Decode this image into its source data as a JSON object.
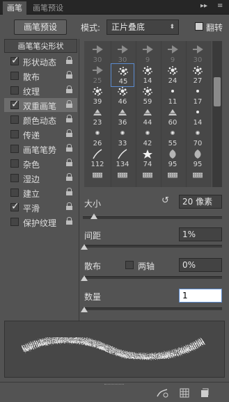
{
  "tabs": [
    {
      "label": "画笔",
      "active": true
    },
    {
      "label": "画笔预设",
      "active": false
    }
  ],
  "tabbar_controls": {
    "collapse": "▸▸",
    "menu": "≡"
  },
  "preset_button": "画笔预设",
  "mode": {
    "label": "模式:",
    "value": "正片叠底",
    "arrow": "⬍"
  },
  "flip": {
    "label": "翻转",
    "checked": false
  },
  "list": {
    "header": "画笔笔尖形状",
    "items": [
      {
        "label": "形状动态",
        "checked": true,
        "selected": false
      },
      {
        "label": "散布",
        "checked": false,
        "selected": false
      },
      {
        "label": "纹理",
        "checked": false,
        "selected": false
      },
      {
        "label": "双重画笔",
        "checked": true,
        "selected": true
      },
      {
        "label": "颜色动态",
        "checked": false,
        "selected": false
      },
      {
        "label": "传递",
        "checked": false,
        "selected": false
      },
      {
        "label": "画笔笔势",
        "checked": false,
        "selected": false
      },
      {
        "label": "杂色",
        "checked": false,
        "selected": false
      },
      {
        "label": "湿边",
        "checked": false,
        "selected": false
      },
      {
        "label": "建立",
        "checked": false,
        "selected": false
      },
      {
        "label": "平滑",
        "checked": true,
        "selected": false
      },
      {
        "label": "保护纹理",
        "checked": false,
        "selected": false
      }
    ]
  },
  "brushes": [
    {
      "num": "30",
      "dim": true,
      "icon": "arrow-brush-icon"
    },
    {
      "num": "30",
      "dim": true,
      "icon": "arrow-brush-icon"
    },
    {
      "num": "9",
      "dim": true,
      "icon": "arrow-brush-icon"
    },
    {
      "num": "9",
      "dim": true,
      "icon": "arrow-brush-icon"
    },
    {
      "num": "30",
      "dim": true,
      "icon": "arrow-brush-icon"
    },
    {
      "num": "25",
      "dim": true,
      "icon": "arrow-brush-icon"
    },
    {
      "num": "45",
      "dim": false,
      "selected": true,
      "icon": "splatter-brush-icon"
    },
    {
      "num": "14",
      "dim": false,
      "icon": "scatter-brush-icon"
    },
    {
      "num": "24",
      "dim": false,
      "icon": "scatter-brush-icon"
    },
    {
      "num": "27",
      "dim": false,
      "icon": "scatter-brush-icon"
    },
    {
      "num": "39",
      "dim": false,
      "icon": "scatter-brush-icon"
    },
    {
      "num": "46",
      "dim": false,
      "icon": "scatter-brush-icon"
    },
    {
      "num": "59",
      "dim": false,
      "icon": "scatter-brush-icon"
    },
    {
      "num": "11",
      "dim": false,
      "icon": "dot-brush-icon"
    },
    {
      "num": "17",
      "dim": false,
      "icon": "dot-brush-icon"
    },
    {
      "num": "23",
      "dim": false,
      "icon": "leaf-brush-icon"
    },
    {
      "num": "36",
      "dim": false,
      "icon": "leaf-brush-icon"
    },
    {
      "num": "44",
      "dim": false,
      "icon": "leaf-brush-icon"
    },
    {
      "num": "60",
      "dim": false,
      "icon": "leaf-brush-icon"
    },
    {
      "num": "14",
      "dim": false,
      "icon": "dot-brush-icon"
    },
    {
      "num": "26",
      "dim": false,
      "icon": "soft-dot-brush-icon"
    },
    {
      "num": "33",
      "dim": false,
      "icon": "soft-dot-brush-icon"
    },
    {
      "num": "42",
      "dim": false,
      "icon": "soft-dot-brush-icon"
    },
    {
      "num": "55",
      "dim": false,
      "icon": "soft-dot-brush-icon"
    },
    {
      "num": "70",
      "dim": false,
      "icon": "soft-dot-brush-icon"
    },
    {
      "num": "112",
      "dim": false,
      "icon": "grass-brush-icon"
    },
    {
      "num": "134",
      "dim": false,
      "icon": "grass-brush-icon"
    },
    {
      "num": "74",
      "dim": false,
      "icon": "star-brush-icon"
    },
    {
      "num": "95",
      "dim": false,
      "icon": "leaf-shape-brush-icon"
    },
    {
      "num": "95",
      "dim": false,
      "icon": "leaf-shape-brush-icon"
    },
    {
      "num": "",
      "dim": false,
      "icon": "texture-brush-icon"
    },
    {
      "num": "",
      "dim": false,
      "icon": "texture-brush-icon"
    },
    {
      "num": "",
      "dim": false,
      "icon": "texture-brush-icon"
    },
    {
      "num": "",
      "dim": false,
      "icon": "texture-brush-icon"
    },
    {
      "num": "",
      "dim": false,
      "icon": "texture-brush-icon"
    }
  ],
  "size": {
    "label": "大小",
    "value": "20 像素",
    "reset_icon": "↺",
    "level": 0.07
  },
  "spacing": {
    "label": "间距",
    "value": "1%",
    "level": 0.0
  },
  "scatter": {
    "label": "散布",
    "both_axes_label": "两轴",
    "both_axes_checked": false,
    "value": "0%",
    "level": 0.0
  },
  "count": {
    "label": "数量",
    "value": "1",
    "level": 0.0
  },
  "bottom_icons": [
    "brush-preview-icon",
    "grid-icon",
    "new-preset-icon"
  ]
}
